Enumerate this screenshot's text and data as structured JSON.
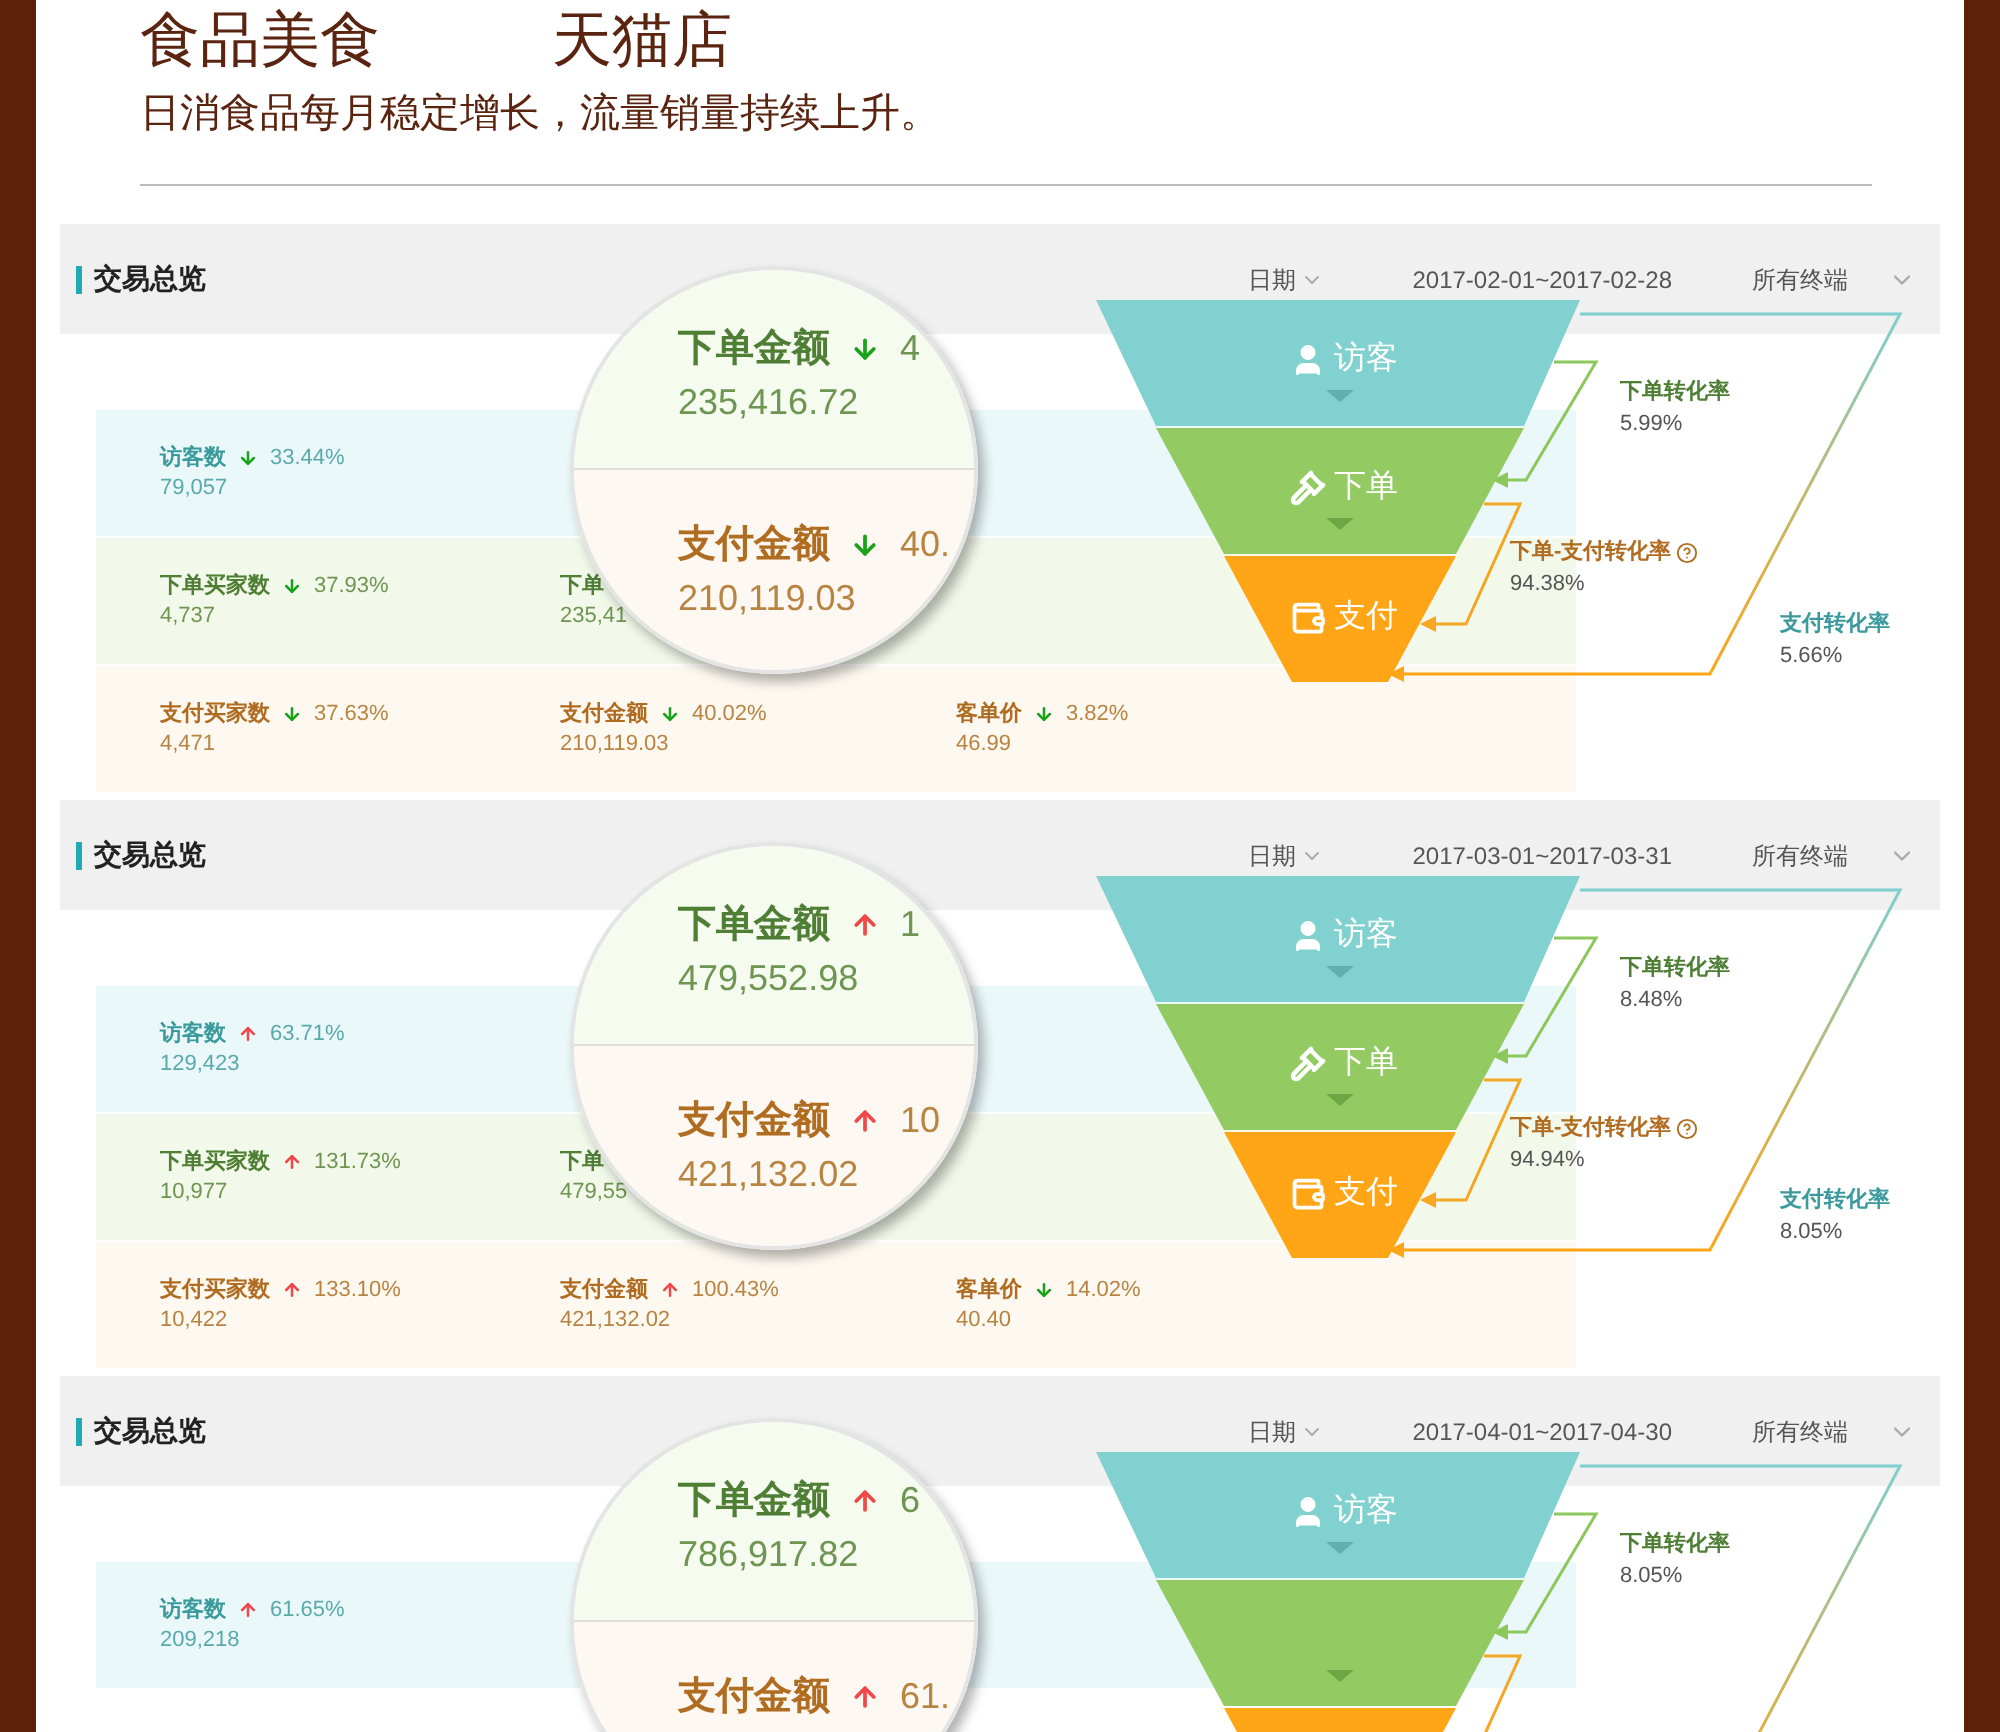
{
  "title": {
    "left": "食品美食",
    "right": "天猫店"
  },
  "subtitle": "日消食品每月稳定增长，流量销量持续上升。",
  "panels": [
    {
      "heading": "交易总览",
      "date_label": "日期",
      "date_range": "2017-02-01~2017-02-28",
      "terminal": "所有终端",
      "rows": [
        {
          "kind": "visitor",
          "cells": [
            {
              "label": "访客数",
              "rising": false,
              "change": "33.44%",
              "value": "79,057"
            }
          ]
        },
        {
          "kind": "order",
          "cells": [
            {
              "label": "下单买家数",
              "rising": false,
              "change": "37.93%",
              "value": "4,737"
            },
            {
              "label": "下单",
              "value": "235,41"
            }
          ]
        },
        {
          "kind": "pay",
          "cells": [
            {
              "label": "支付买家数",
              "rising": false,
              "change": "37.63%",
              "value": "4,471"
            },
            {
              "label": "支付金额",
              "rising": false,
              "change": "40.02%",
              "value": "210,119.03"
            },
            {
              "label": "客单价",
              "rising": false,
              "change": "3.82%",
              "value": "46.99"
            }
          ]
        }
      ],
      "magnifier": {
        "order": {
          "label": "下单金额",
          "rising": false,
          "change": "4",
          "value": "235,416.72"
        },
        "pay": {
          "label": "支付金额",
          "rising": false,
          "change": "40.",
          "value": "210,119.03"
        }
      },
      "funnel": {
        "stages": [
          {
            "kind": "visitor",
            "label": "访客"
          },
          {
            "kind": "order",
            "label": "下单"
          },
          {
            "kind": "pay",
            "label": "支付"
          }
        ],
        "rates": [
          {
            "kind": "order",
            "label": "下单转化率",
            "value": "5.99%"
          },
          {
            "kind": "order_pay",
            "label": "下单-支付转化率",
            "value": "94.38%"
          },
          {
            "kind": "pay",
            "label": "支付转化率",
            "value": "5.66%"
          }
        ]
      }
    },
    {
      "heading": "交易总览",
      "date_label": "日期",
      "date_range": "2017-03-01~2017-03-31",
      "terminal": "所有终端",
      "rows": [
        {
          "kind": "visitor",
          "cells": [
            {
              "label": "访客数",
              "rising": true,
              "change": "63.71%",
              "value": "129,423"
            }
          ]
        },
        {
          "kind": "order",
          "cells": [
            {
              "label": "下单买家数",
              "rising": true,
              "change": "131.73%",
              "value": "10,977"
            },
            {
              "label": "下单",
              "value": "479,55"
            }
          ]
        },
        {
          "kind": "pay",
          "cells": [
            {
              "label": "支付买家数",
              "rising": true,
              "change": "133.10%",
              "value": "10,422"
            },
            {
              "label": "支付金额",
              "rising": true,
              "change": "100.43%",
              "value": "421,132.02"
            },
            {
              "label": "客单价",
              "rising": false,
              "change": "14.02%",
              "value": "40.40"
            }
          ]
        }
      ],
      "magnifier": {
        "order": {
          "label": "下单金额",
          "rising": true,
          "change": "1",
          "value": "479,552.98"
        },
        "pay": {
          "label": "支付金额",
          "rising": true,
          "change": "10",
          "value": "421,132.02"
        }
      },
      "funnel": {
        "stages": [
          {
            "kind": "visitor",
            "label": "访客"
          },
          {
            "kind": "order",
            "label": "下单"
          },
          {
            "kind": "pay",
            "label": "支付"
          }
        ],
        "rates": [
          {
            "kind": "order",
            "label": "下单转化率",
            "value": "8.48%"
          },
          {
            "kind": "order_pay",
            "label": "下单-支付转化率",
            "value": "94.94%"
          },
          {
            "kind": "pay",
            "label": "支付转化率",
            "value": "8.05%"
          }
        ]
      }
    },
    {
      "heading": "交易总览",
      "date_label": "日期",
      "date_range": "2017-04-01~2017-04-30",
      "terminal": "所有终端",
      "rows": [
        {
          "kind": "visitor",
          "cells": [
            {
              "label": "访客数",
              "rising": true,
              "change": "61.65%",
              "value": "209,218"
            }
          ]
        }
      ],
      "magnifier": {
        "order": {
          "label": "下单金额",
          "rising": true,
          "change": "6",
          "value": "786,917.82"
        },
        "pay": {
          "label": "支付金额",
          "rising": true,
          "change": "61."
        }
      },
      "funnel": {
        "stages": [
          {
            "kind": "visitor",
            "label": "访客"
          }
        ],
        "rates": [
          {
            "kind": "order",
            "label": "下单转化率",
            "value": "8.05%"
          }
        ]
      }
    }
  ]
}
